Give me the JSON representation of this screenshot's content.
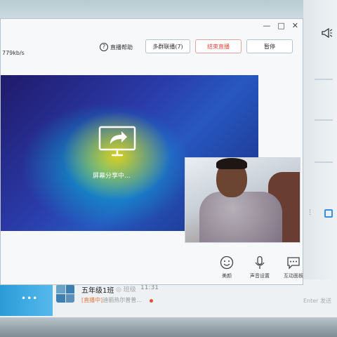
{
  "window": {
    "bitrate": "779kb/s",
    "help_label": "直播帮助",
    "buttons": {
      "multi_group": "多群联播(7)",
      "end_live": "结束直播",
      "pause": "暂停"
    },
    "controls": [
      "—",
      "□",
      "✕"
    ]
  },
  "screen_share": {
    "status_text": "屏幕分享中..."
  },
  "toolbar": {
    "face_label": "美颜",
    "mic_label": "声音设置",
    "chat_label": "互动面板"
  },
  "chat_list": {
    "item": {
      "name": "五年级1班",
      "badge": "◎ 班级",
      "time": "11:31",
      "preview_highlight": "[直播中]",
      "preview_rest": "迪丽热尔普普..."
    },
    "right_text": "Enter 发送"
  },
  "colors": {
    "accent_blue": "#2a9bd8",
    "end_red": "#e04a3a"
  },
  "icons": [
    "megaphone-icon",
    "help-icon",
    "screen-share-icon",
    "smile-icon",
    "microphone-icon",
    "chat-bubble-icon",
    "calendar-icon"
  ]
}
